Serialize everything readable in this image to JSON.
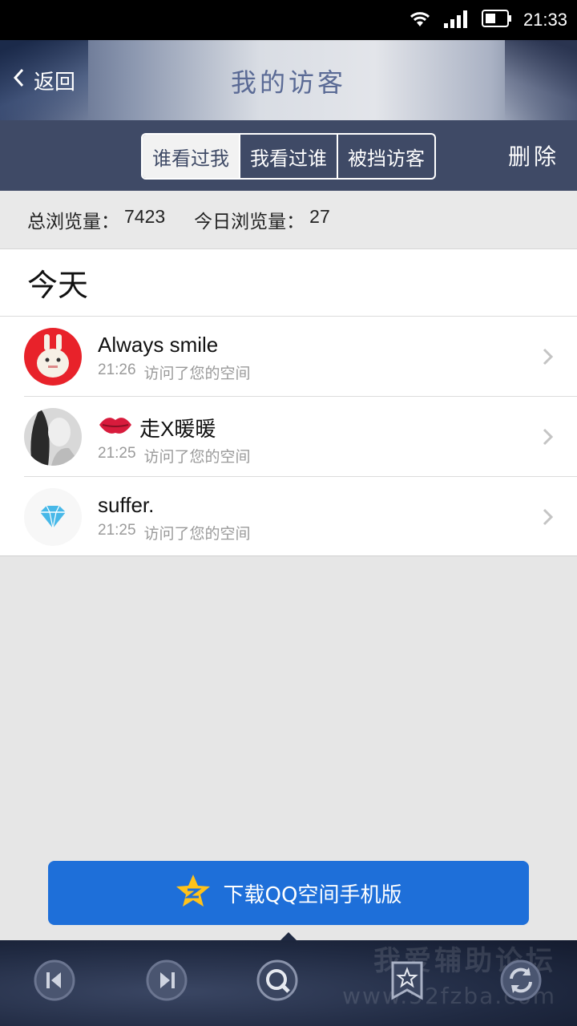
{
  "status_bar": {
    "time": "21:33"
  },
  "header": {
    "back_label": "返回",
    "title": "我的访客"
  },
  "tabs": [
    {
      "label": "谁看过我",
      "selected": true
    },
    {
      "label": "我看过谁",
      "selected": false
    },
    {
      "label": "被挡访客",
      "selected": false
    }
  ],
  "delete_label": "删除",
  "stats": {
    "total_label": "总浏览量：",
    "total_value": "7423",
    "today_label": "今日浏览量：",
    "today_value": "27"
  },
  "section_title": "今天",
  "visitors": [
    {
      "name": "Always smile",
      "time": "21:26",
      "action": "访问了您的空间"
    },
    {
      "name": "走X暖暖",
      "time": "21:25",
      "action": "访问了您的空间"
    },
    {
      "name": "suffer.",
      "time": "21:25",
      "action": "访问了您的空间"
    }
  ],
  "download_label": "下载QQ空间手机版",
  "watermark": {
    "line1": "我爱辅助论坛",
    "line2": "www.52fzba.com"
  },
  "colors": {
    "header_bar": "#3f4a66",
    "download_button": "#1e6fd9",
    "background": "#e6e6e6"
  }
}
